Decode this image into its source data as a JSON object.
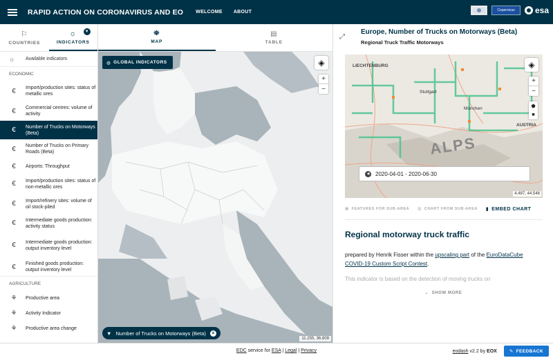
{
  "header": {
    "title": "RAPID ACTION ON CORONAVIRUS AND EO",
    "nav": [
      "WELCOME",
      "ABOUT"
    ],
    "logos": [
      "copernicus",
      "esa"
    ],
    "esa_label": "esa",
    "copernicus_label": "Copernicus"
  },
  "sidebar": {
    "tabs": [
      {
        "label": "COUNTRIES",
        "icon": "flag-icon"
      },
      {
        "label": "INDICATORS",
        "icon": "lightbulb-icon",
        "badge": "▼"
      }
    ],
    "available_label": "Available indicators",
    "sections": [
      {
        "title": "ECONOMIC",
        "items": [
          {
            "label": "Import/production sites: status of metallic ores",
            "icon": "euro-icon"
          },
          {
            "label": "Commercial centres: volume of activity",
            "icon": "euro-icon"
          },
          {
            "label": "Number of Trucks on Motorways (Beta)",
            "icon": "euro-icon",
            "active": true
          },
          {
            "label": "Number of Trucks on Primary Roads (Beta)",
            "icon": "euro-icon"
          },
          {
            "label": "Airports: Throughput",
            "icon": "euro-icon"
          },
          {
            "label": "Import/production sites: status of non-metallic ores",
            "icon": "euro-icon"
          },
          {
            "label": "Import/refinery sites: volume of oil stock-piled",
            "icon": "euro-icon"
          },
          {
            "label": "Intermediate goods production: activity status",
            "icon": "euro-icon"
          },
          {
            "label": "Intermediate goods production: output inventory level",
            "icon": "euro-icon"
          },
          {
            "label": "Finished goods production: output inventory level",
            "icon": "euro-icon"
          }
        ]
      },
      {
        "title": "AGRICULTURE",
        "items": [
          {
            "label": "Productive area",
            "icon": "wheat-icon"
          },
          {
            "label": "Activity Indicator",
            "icon": "wheat-icon"
          },
          {
            "label": "Productive area change",
            "icon": "wheat-icon"
          }
        ]
      }
    ]
  },
  "main": {
    "tabs": [
      {
        "label": "MAP",
        "active": true
      },
      {
        "label": "TABLE",
        "active": false
      }
    ],
    "global_button": "GLOBAL INDICATORS",
    "filter_chip": "Number of Trucks on Motorways (Beta)",
    "coords": "11.255, 36.809"
  },
  "panel": {
    "title": "Europe, Number of Trucks on Motorways (Beta)",
    "subtitle": "Regional Truck Traffic Motorways",
    "map_labels": {
      "region1": "LIECHTENBURG",
      "city1": "Stuttgart",
      "city2": "München",
      "range": "ALPS",
      "country": "AUSTRIA"
    },
    "time_range": "2020-04-01 - 2020-06-30",
    "mini_coords": "4.487, 44.546",
    "actions": [
      "FEATURES FOR SUB-AREA",
      "CHART FROM SUB-AREA",
      "EMBED CHART"
    ],
    "desc_title": "Regional motorway truck traffic",
    "desc_p1": "prepared by Henrik Fisser within the",
    "desc_link1": "upscaling part",
    "desc_p2": "of the",
    "desc_link2": "EuroDataCube COVID-19 Custom Script Contest",
    "desc_p3": ".",
    "desc_faded": "This indicator is based on the detection of moving trucks on",
    "show_more": "SHOW MORE"
  },
  "footer": {
    "edc": "EDC",
    "service_for": "service for",
    "esa": "ESA",
    "legal": "Legal",
    "privacy": "Privacy",
    "eodash": "eodash",
    "version": "v2.2 by",
    "eox": "EOX",
    "feedback": "FEEDBACK"
  },
  "colors": {
    "primary": "#003247",
    "feedback": "#1876d2"
  }
}
